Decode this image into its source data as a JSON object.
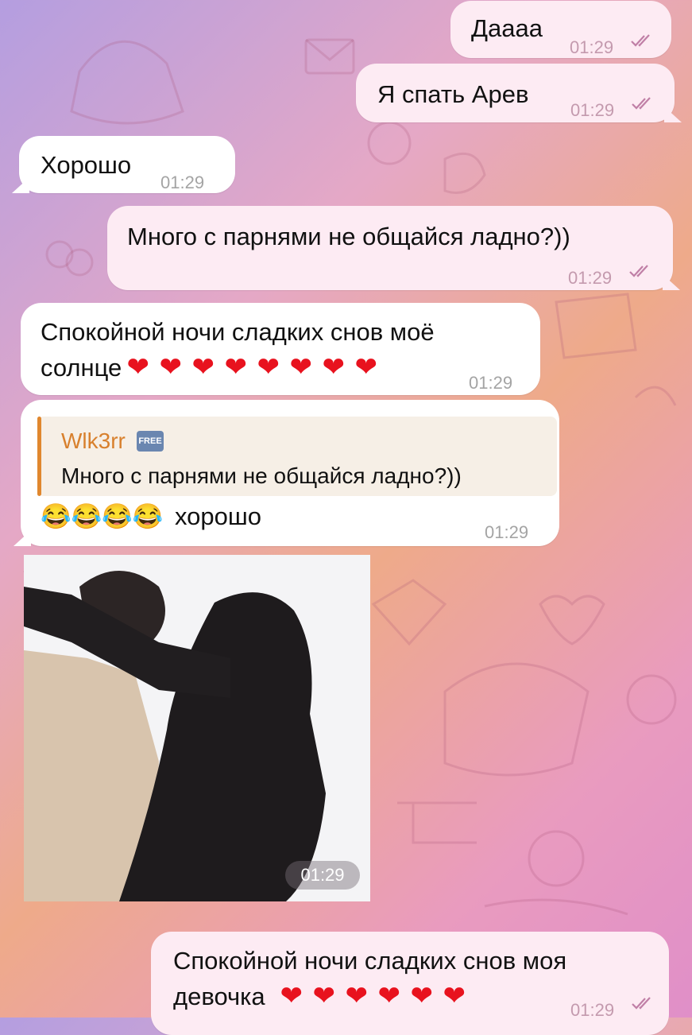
{
  "chat": {
    "messages": [
      {
        "id": "m1",
        "direction": "outgoing",
        "text": "Даааа",
        "time": "01:29",
        "status": "read"
      },
      {
        "id": "m2",
        "direction": "outgoing",
        "text": "Я спать Арев",
        "time": "01:29",
        "status": "read"
      },
      {
        "id": "m3",
        "direction": "incoming",
        "text": "Хорошо",
        "time": "01:29"
      },
      {
        "id": "m4",
        "direction": "outgoing",
        "text": "Много с парнями не общайся ладно?))",
        "time": "01:29",
        "status": "read"
      },
      {
        "id": "m5",
        "direction": "incoming",
        "line1": "Спокойной ночи сладких снов моё",
        "line2": "солнце",
        "hearts": 8,
        "time": "01:29"
      },
      {
        "id": "m6",
        "direction": "incoming",
        "reply_name": "Wlk3rr",
        "reply_badge": "FREE",
        "reply_text": "Много с парнями не общайся ладно?))",
        "emoji": "😂😂😂😂",
        "text": "хорошо",
        "time": "01:29"
      },
      {
        "id": "m7",
        "direction": "incoming",
        "type": "video",
        "time": "01:29"
      },
      {
        "id": "m8",
        "direction": "outgoing",
        "line1": "Спокойной ночи сладких снов моя",
        "line2": "девочка",
        "hearts": 6,
        "time": "01:29",
        "status": "read"
      }
    ]
  },
  "icons": {
    "read_status": "double-check-icon",
    "heart": "red-heart-emoji",
    "laugh": "face-with-tears-of-joy-emoji"
  },
  "colors": {
    "outgoing_bubble": "#fdebf3",
    "incoming_bubble": "#ffffff",
    "reply_accent": "#e0872e",
    "heart": "#e8121e",
    "check": "#c07fa6"
  }
}
